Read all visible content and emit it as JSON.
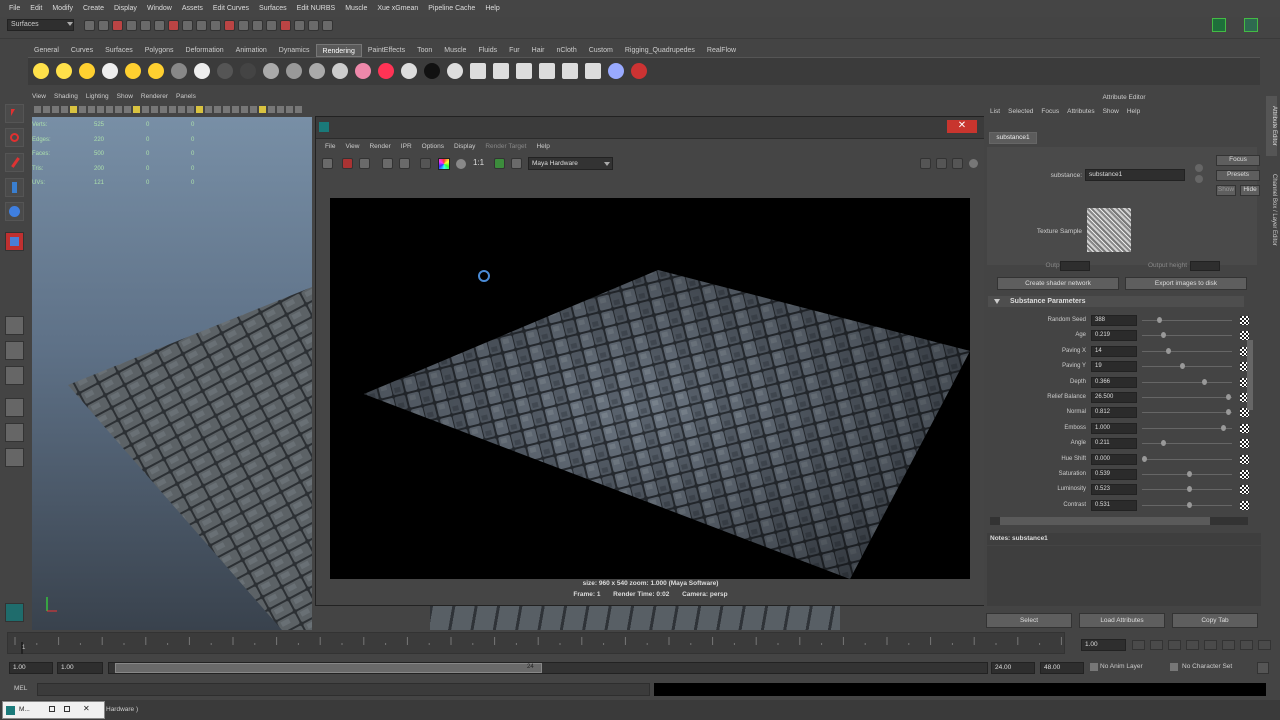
{
  "menubar": [
    "File",
    "Edit",
    "Modify",
    "Create",
    "Display",
    "Window",
    "Assets",
    "Edit Curves",
    "Surfaces",
    "Edit NURBS",
    "Muscle",
    "Xue xGmean",
    "Pipeline Cache",
    "Help"
  ],
  "mode_selector": "Surfaces",
  "shelf_tabs": [
    "General",
    "Curves",
    "Surfaces",
    "Polygons",
    "Deformation",
    "Animation",
    "Dynamics",
    "Rendering",
    "PaintEffects",
    "Toon",
    "Muscle",
    "Fluids",
    "Fur",
    "Hair",
    "nCloth",
    "Custom",
    "Rigging_Quadrupedes",
    "RealFlow"
  ],
  "shelf_active_tab": "Rendering",
  "viewport": {
    "menu": [
      "View",
      "Shading",
      "Lighting",
      "Show",
      "Renderer",
      "Panels"
    ],
    "hud": [
      {
        "label": "Verts:",
        "a": "525",
        "b": "0",
        "c": "0"
      },
      {
        "label": "Edges:",
        "a": "220",
        "b": "0",
        "c": "0"
      },
      {
        "label": "Faces:",
        "a": "500",
        "b": "0",
        "c": "0"
      },
      {
        "label": "Tris:",
        "a": "200",
        "b": "0",
        "c": "0"
      },
      {
        "label": "UVs:",
        "a": "121",
        "b": "0",
        "c": "0"
      }
    ]
  },
  "render_view": {
    "menu": [
      "File",
      "View",
      "Render",
      "IPR",
      "Options",
      "Display",
      "Render Target",
      "Help"
    ],
    "ratio_label": "1:1",
    "renderer": "Maya Hardware",
    "stat_line1": "size: 960 x 540  zoom: 1.000        (Maya Software)",
    "stat_line2_frame": "Frame: 1",
    "stat_line2_time": "Render Time: 0:02",
    "stat_line2_camera": "Camera: persp"
  },
  "attribute_editor": {
    "title": "Attribute Editor",
    "menu": [
      "List",
      "Selected",
      "Focus",
      "Attributes",
      "Show",
      "Help"
    ],
    "tab": "substance1",
    "node_label": "substance:",
    "node_value": "substance1",
    "focus_btn": "Focus",
    "presets_btn": "Presets",
    "show_btn": "Show",
    "hide_btn": "Hide",
    "texture_label": "Texture Sample",
    "output_width": "Output width",
    "output_height": "Output height",
    "create_btn": "Create shader network",
    "export_btn": "Export images to disk",
    "section": "Substance Parameters",
    "params": [
      {
        "label": "Random Seed",
        "value": "388",
        "knob": 0.18
      },
      {
        "label": "Age",
        "value": "0.219",
        "knob": 0.22
      },
      {
        "label": "Paving X",
        "value": "14",
        "knob": 0.28
      },
      {
        "label": "Paving Y",
        "value": "19",
        "knob": 0.44
      },
      {
        "label": "Depth",
        "value": "0.366",
        "knob": 0.7
      },
      {
        "label": "Relief Balance",
        "value": "26.500",
        "knob": 0.98
      },
      {
        "label": "Normal",
        "value": "0.812",
        "knob": 0.98
      },
      {
        "label": "Emboss",
        "value": "1.000",
        "knob": 0.92
      },
      {
        "label": "Angle",
        "value": "0.211",
        "knob": 0.22
      },
      {
        "label": "Hue Shift",
        "value": "0.000",
        "knob": 0.0
      },
      {
        "label": "Saturation",
        "value": "0.539",
        "knob": 0.52
      },
      {
        "label": "Luminosity",
        "value": "0.523",
        "knob": 0.52
      },
      {
        "label": "Contrast",
        "value": "0.531",
        "knob": 0.52
      }
    ],
    "notes": "Notes: substance1",
    "select_btn": "Select",
    "load_btn": "Load Attributes",
    "copy_btn": "Copy Tab",
    "side_tabs": [
      "Attribute Editor",
      "Channel Box / Layer Editor"
    ]
  },
  "timeline": {
    "ticks": [
      "1"
    ],
    "current": "1.00"
  },
  "range": {
    "start": "1.00",
    "start2": "1.00",
    "range_mark": "24",
    "end": "24.00",
    "end2": "48.00",
    "anim_layer": "No Anim Layer",
    "char_set": "No Character Set"
  },
  "mel_label": "MEL",
  "taskbar": {
    "item": "M...",
    "label": "Hardware )"
  }
}
